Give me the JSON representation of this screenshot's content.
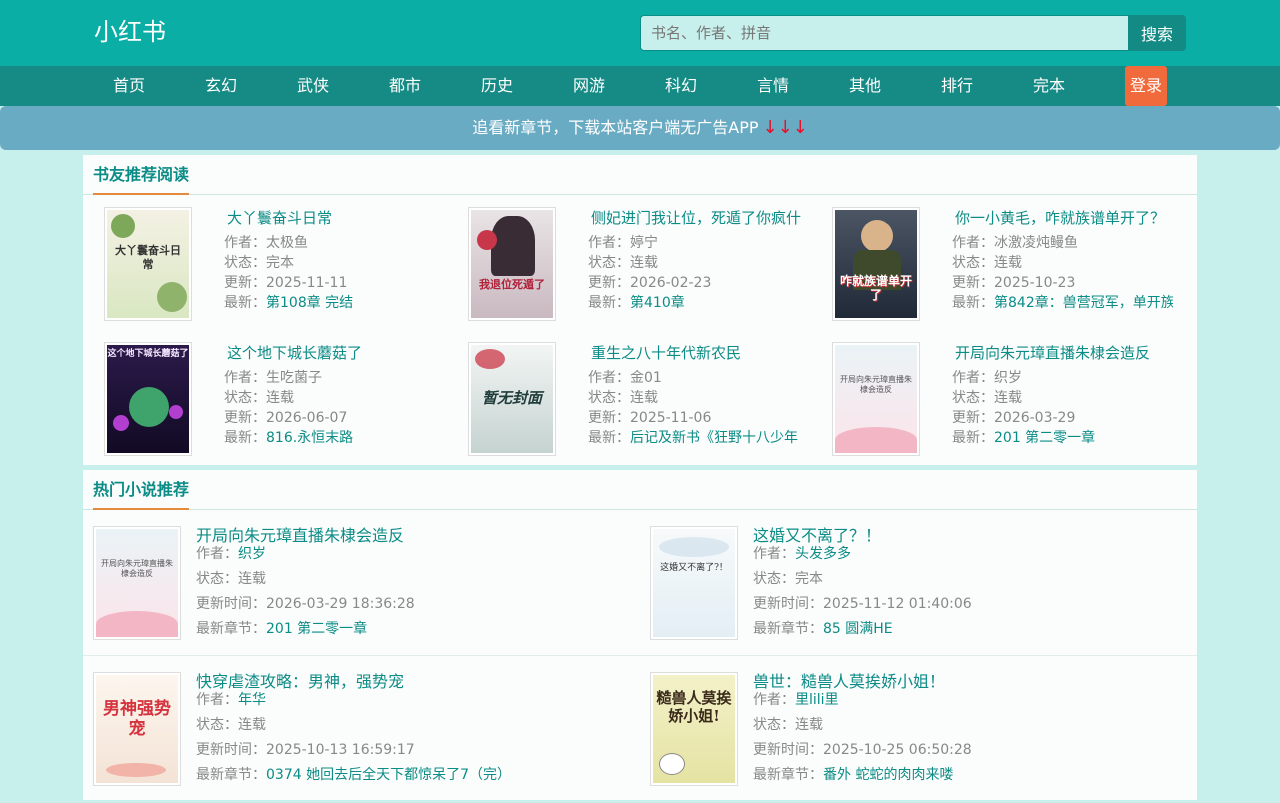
{
  "header": {
    "logo": "小红书",
    "search_placeholder": "书名、作者、拼音",
    "search_button": "搜索"
  },
  "nav": {
    "items": [
      "首页",
      "玄幻",
      "武侠",
      "都市",
      "历史",
      "网游",
      "科幻",
      "言情",
      "其他",
      "排行",
      "完本"
    ],
    "login": "登录"
  },
  "banner": {
    "text": "追看新章节，下载本站客户端无广告APP",
    "arrows": "↓↓↓"
  },
  "recommend": {
    "title": "书友推荐阅读",
    "labels": {
      "author": "作者：",
      "status": "状态：",
      "updated": "更新：",
      "latest": "最新："
    },
    "books": [
      {
        "title": "大丫鬟奋斗日常",
        "author": "太极鱼",
        "status": "完本",
        "updated": "2025-11-11",
        "latest": "第108章 完结",
        "cover_text": "大丫鬟奋斗日常"
      },
      {
        "title": "侧妃进门我让位，死遁了你疯什",
        "author": "婷宁",
        "status": "连载",
        "updated": "2026-02-23",
        "latest": "第410章",
        "cover_text": "我退位死遁了"
      },
      {
        "title": "你一小黄毛，咋就族谱单开了？",
        "author": "冰激凌炖鳗鱼",
        "status": "连载",
        "updated": "2025-10-23",
        "latest": "第842章：兽营冠军，单开族",
        "cover_text": "咋就族谱单开了"
      },
      {
        "title": "这个地下城长蘑菇了",
        "author": "生吃菌子",
        "status": "连载",
        "updated": "2026-06-07",
        "latest": "816.永恒末路",
        "cover_text": "这个地下城长蘑菇了"
      },
      {
        "title": "重生之八十年代新农民",
        "author": "金01",
        "status": "连载",
        "updated": "2025-11-06",
        "latest": "后记及新书《狂野十八少年",
        "cover_text": "暂无封面"
      },
      {
        "title": "开局向朱元璋直播朱棣会造反",
        "author": "织岁",
        "status": "连载",
        "updated": "2026-03-29",
        "latest": "201 第二零一章",
        "cover_text": "开局向朱元璋直播朱棣会造反"
      }
    ]
  },
  "hot": {
    "title": "热门小说推荐",
    "labels": {
      "author": "作者：",
      "status": "状态：",
      "updated": "更新时间：",
      "latest": "最新章节："
    },
    "books": [
      {
        "title": "开局向朱元璋直播朱棣会造反",
        "author": "织岁",
        "status": "连载",
        "updated": "2026-03-29 18:36:28",
        "latest": "201 第二零一章",
        "cover_text": "开局向朱元璋直播朱棣会造反"
      },
      {
        "title": "这婚又不离了？！",
        "author": "头发多多",
        "status": "完本",
        "updated": "2025-11-12 01:40:06",
        "latest": "85 圆满HE",
        "cover_text": "这婚又不离了?！"
      },
      {
        "title": "快穿虐渣攻略：男神，强势宠",
        "author": "年华",
        "status": "连载",
        "updated": "2025-10-13 16:59:17",
        "latest": "0374 她回去后全天下都惊呆了7（完）",
        "cover_text": "男神强势宠"
      },
      {
        "title": "兽世：糙兽人莫挨娇小姐！",
        "author": "里lili里",
        "status": "连载",
        "updated": "2025-10-25 06:50:28",
        "latest": "番外 蛇蛇的肉肉来喽",
        "cover_text": "糙兽人莫挨娇小姐!"
      }
    ]
  },
  "colors": {
    "header_bg": "#0aaea5",
    "nav_bg": "#168a84",
    "login_bg": "#f06a3c",
    "link": "#0c8c86",
    "page_bg": "#c7efeb"
  }
}
